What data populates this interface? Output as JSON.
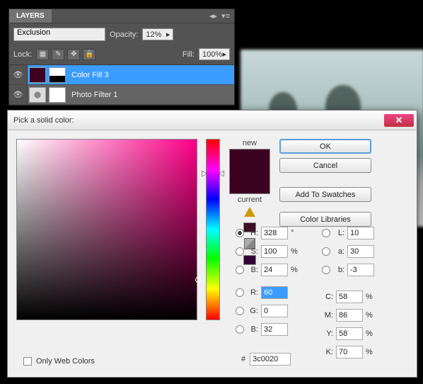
{
  "layers": {
    "tab": "LAYERS",
    "blend_mode": "Exclusion",
    "opacity_label": "Opacity:",
    "opacity_value": "12%",
    "lock_label": "Lock:",
    "fill_label": "Fill:",
    "fill_value": "100%",
    "items": [
      {
        "name": "Color Fill 3"
      },
      {
        "name": "Photo Filter 1"
      }
    ]
  },
  "picker": {
    "title": "Pick a solid color:",
    "new_label": "new",
    "current_label": "current",
    "ok": "OK",
    "cancel": "Cancel",
    "add_swatches": "Add To Swatches",
    "color_libraries": "Color Libraries",
    "only_web": "Only Web Colors",
    "hex_label": "#",
    "hex": "3c0020",
    "hsb": {
      "h": "328",
      "s": "100",
      "b": "24"
    },
    "rgb": {
      "r": "60",
      "g": "0",
      "b": "32"
    },
    "lab": {
      "l": "10",
      "a": "30",
      "b": "-3"
    },
    "cmyk": {
      "c": "58",
      "m": "86",
      "y": "58",
      "k": "70"
    }
  }
}
